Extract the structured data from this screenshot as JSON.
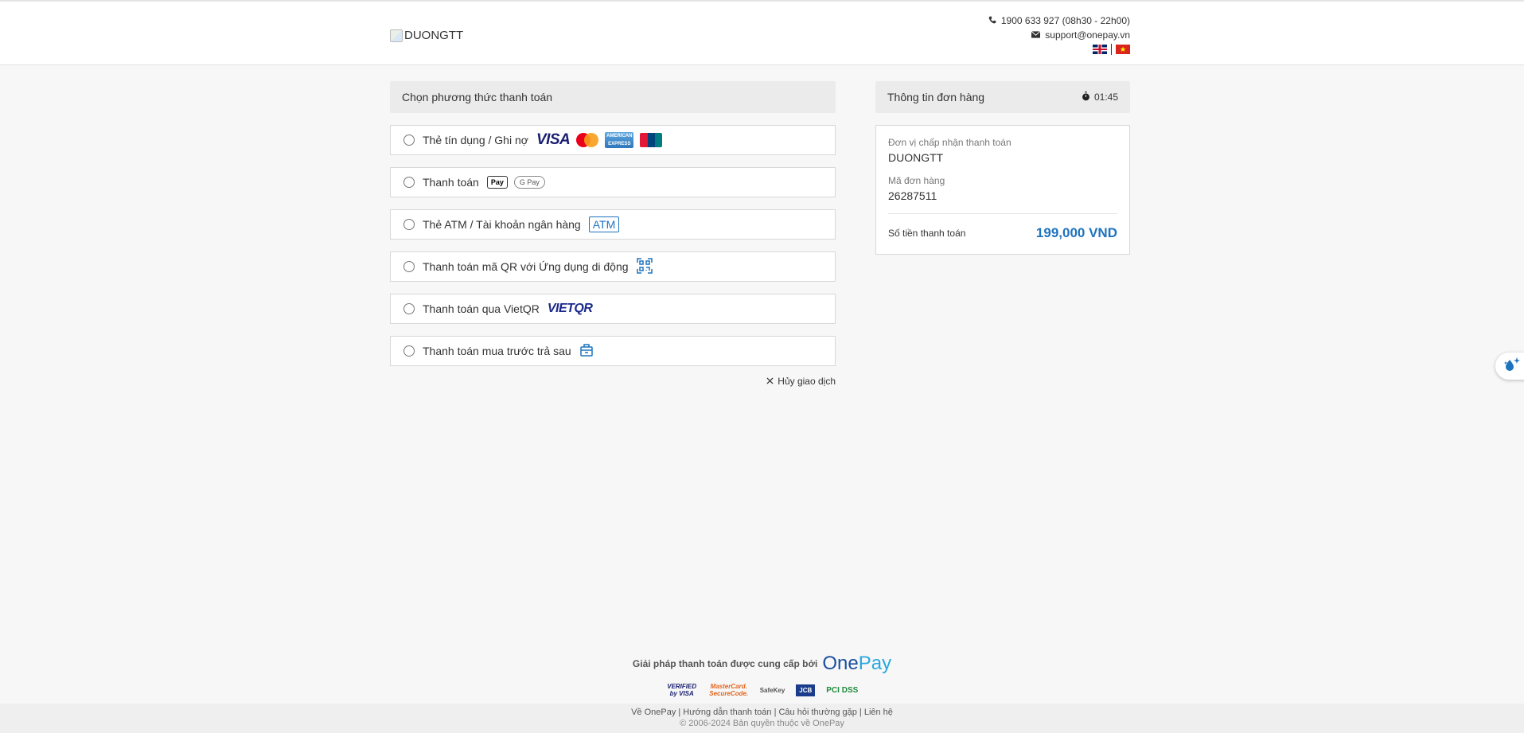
{
  "header": {
    "merchant_logo_alt": "DUONGTT",
    "hotline": "1900 633 927 (08h30 - 22h00)",
    "email": "support@onepay.vn",
    "languages": [
      "English",
      "Tiếng Việt"
    ]
  },
  "payment": {
    "title": "Chọn phương thức thanh toán",
    "methods": [
      {
        "label": "Thẻ tín dụng / Ghi nợ",
        "logos": [
          "visa-logo",
          "mastercard-logo",
          "amex-logo",
          "unionpay-logo"
        ]
      },
      {
        "label": "Thanh toán",
        "logos": [
          "applepay-logo",
          "googlepay-logo"
        ],
        "applepay_text": " Pay",
        "gpay_text": "G Pay"
      },
      {
        "label": "Thẻ ATM / Tài khoản ngân hàng",
        "logos": [
          "atm-logo"
        ],
        "atm_text": "ATM"
      },
      {
        "label": "Thanh toán mã QR với Ứng dụng di động",
        "logos": [
          "qr-icon"
        ]
      },
      {
        "label": "Thanh toán qua VietQR",
        "logos": [
          "vietqr-logo"
        ],
        "vietqr_text": "VIETQR"
      },
      {
        "label": "Thanh toán mua trước trả sau",
        "logos": [
          "bag-icon"
        ]
      }
    ],
    "visa_text": "VISA",
    "cancel_label": "Hủy giao dịch"
  },
  "order": {
    "title": "Thông tin đơn hàng",
    "timer": "01:45",
    "merchant_label": "Đơn vị chấp nhận thanh toán",
    "merchant_value": "DUONGTT",
    "order_label": "Mã đơn hàng",
    "order_value": "26287511",
    "total_label": "Số tiền thanh toán",
    "total_value": "199,000 VND"
  },
  "footer": {
    "brand_text": "Giải pháp thanh toán được cung cấp bởi",
    "brand_logo_one": "One",
    "brand_logo_pay": "Pay",
    "links": "Về OnePay | Hướng dẫn thanh toán | Câu hỏi thường gặp | Liên hệ",
    "copyright": "© 2006-2024 Bản quyền thuộc về OnePay",
    "badges": {
      "visa": "VERIFIED by VISA",
      "mastercard": "MasterCard. SecureCode.",
      "amex": "SafeKey",
      "jcb": "JCB",
      "pci": "PCI DSS"
    }
  },
  "colors": {
    "accent": "#1e73be",
    "panel_head": "#ebebeb",
    "background": "#f7f7f7"
  }
}
